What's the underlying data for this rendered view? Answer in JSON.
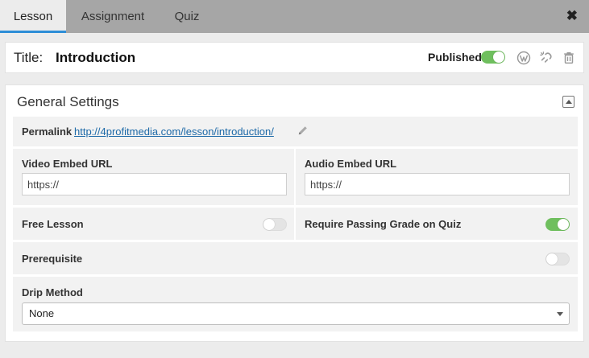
{
  "tabs": [
    {
      "label": "Lesson",
      "active": true
    },
    {
      "label": "Assignment",
      "active": false
    },
    {
      "label": "Quiz",
      "active": false
    }
  ],
  "close_glyph": "✖",
  "header": {
    "title_label": "Title:",
    "title_value": "Introduction",
    "published_label": "Published",
    "published_on": true,
    "icons": [
      "wordpress-icon",
      "unlink-icon",
      "trash-icon"
    ]
  },
  "settings": {
    "title": "General Settings",
    "permalink_label": "Permalink",
    "permalink_url": "http://4profitmedia.com/lesson/introduction/",
    "video_label": "Video Embed URL",
    "video_placeholder": "https://",
    "audio_label": "Audio Embed URL",
    "audio_placeholder": "https://",
    "free_lesson_label": "Free Lesson",
    "free_lesson_on": false,
    "require_grade_label": "Require Passing Grade on Quiz",
    "require_grade_on": true,
    "prerequisite_label": "Prerequisite",
    "prerequisite_on": false,
    "drip_label": "Drip Method",
    "drip_value": "None"
  },
  "colors": {
    "accent": "#2d8ed7",
    "toggle_on": "#6fbf5e",
    "link": "#1e6aa8"
  }
}
